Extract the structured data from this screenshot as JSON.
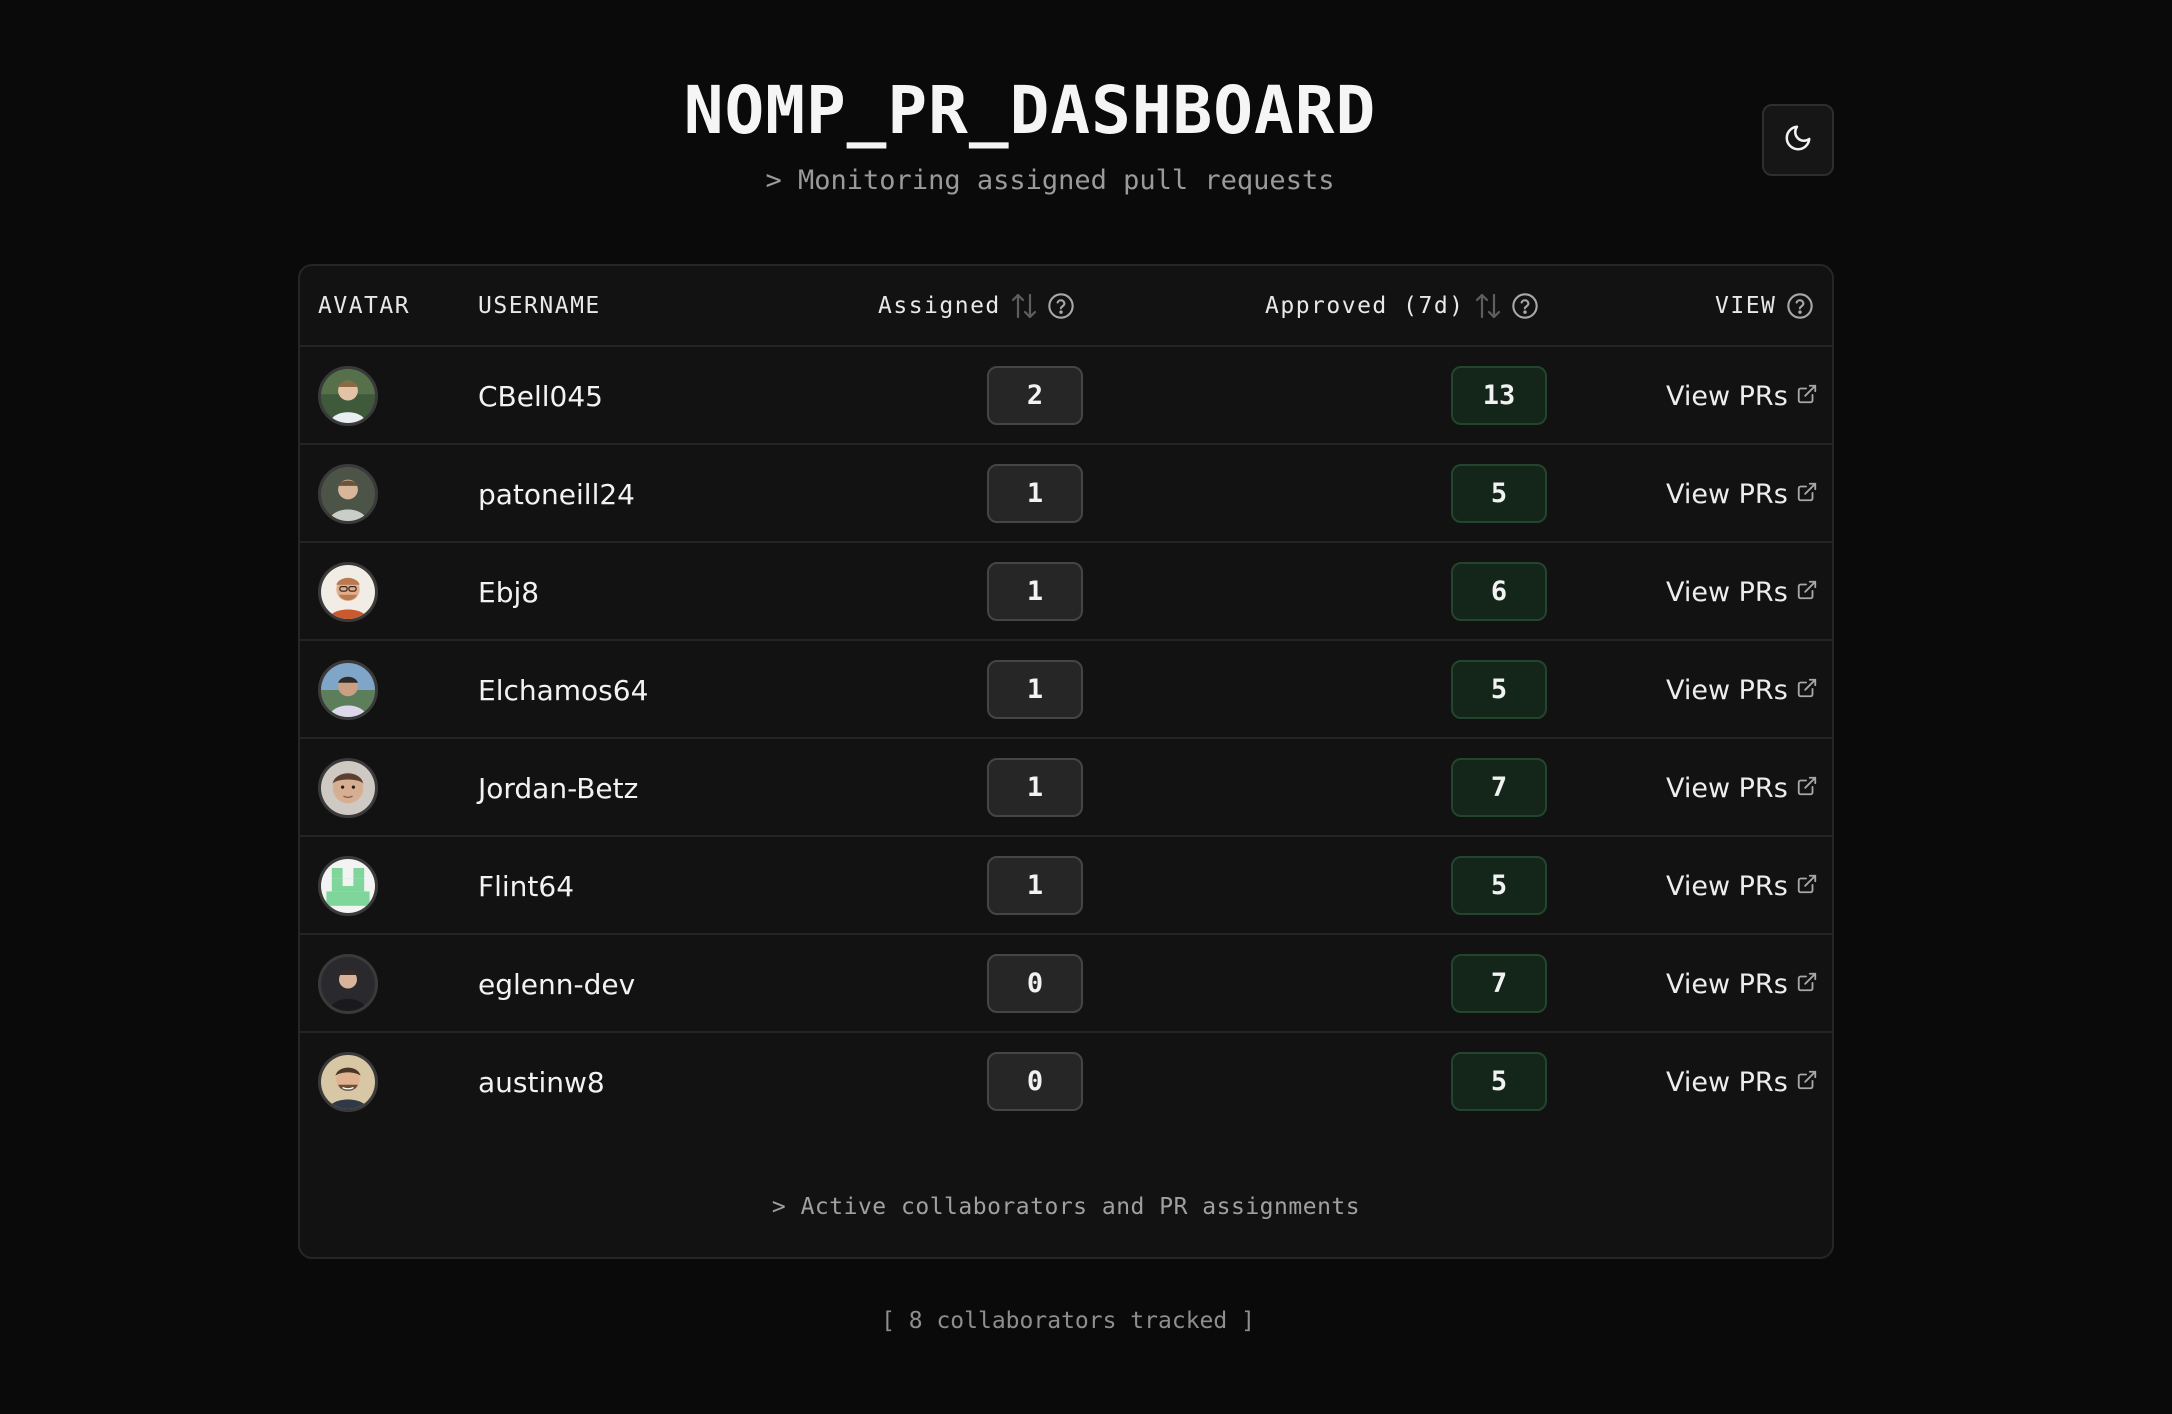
{
  "header": {
    "title": "NOMP_PR_DASHBOARD",
    "subtitle": "> Monitoring assigned pull requests"
  },
  "theme_toggle": {
    "icon": "moon-icon"
  },
  "table": {
    "columns": {
      "avatar": "AVATAR",
      "username": "USERNAME",
      "assigned": "Assigned",
      "approved": "Approved (7d)",
      "view": "VIEW"
    },
    "rows": [
      {
        "username": "CBell045",
        "assigned": "2",
        "approved": "13",
        "view": "View PRs"
      },
      {
        "username": "patoneill24",
        "assigned": "1",
        "approved": "5",
        "view": "View PRs"
      },
      {
        "username": "Ebj8",
        "assigned": "1",
        "approved": "6",
        "view": "View PRs"
      },
      {
        "username": "Elchamos64",
        "assigned": "1",
        "approved": "5",
        "view": "View PRs"
      },
      {
        "username": "Jordan-Betz",
        "assigned": "1",
        "approved": "7",
        "view": "View PRs"
      },
      {
        "username": "Flint64",
        "assigned": "1",
        "approved": "5",
        "view": "View PRs"
      },
      {
        "username": "eglenn-dev",
        "assigned": "0",
        "approved": "7",
        "view": "View PRs"
      },
      {
        "username": "austinw8",
        "assigned": "0",
        "approved": "5",
        "view": "View PRs"
      }
    ],
    "footer": "> Active collaborators and PR assignments"
  },
  "page_footer": "[ 8 collaborators tracked ]",
  "colors": {
    "background": "#0a0a0a",
    "card": "#121212",
    "assigned_badge": "#262626",
    "approved_badge": "#14251a"
  }
}
